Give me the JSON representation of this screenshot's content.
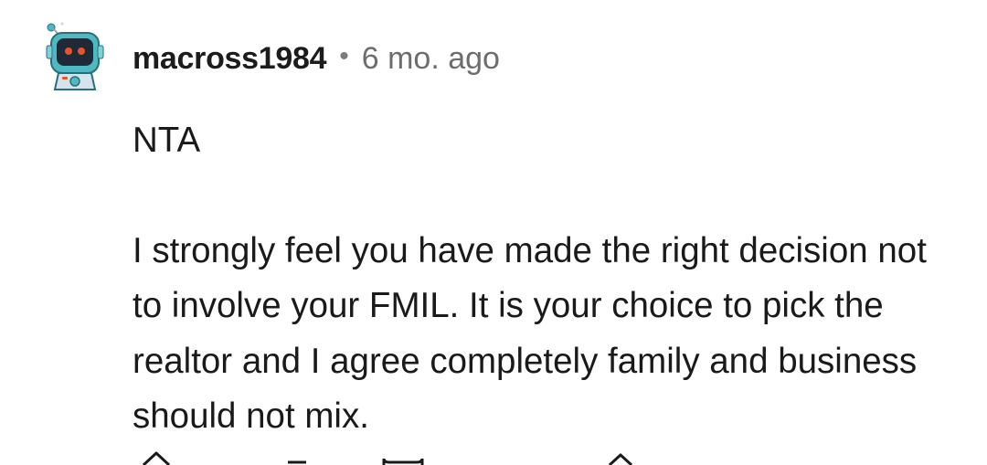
{
  "comment": {
    "username": "macross1984",
    "separator": "•",
    "timestamp": "6 mo. ago",
    "paragraphs": [
      "NTA",
      "I strongly feel you have made the right decision not to involve your FMIL. It is your choice to pick the realtor and I agree completely family and business should not mix."
    ]
  },
  "icons": {
    "avatar": "robot-avatar-icon",
    "actions": [
      "upvote-icon",
      "downvote-icon",
      "reply-icon",
      "share-icon"
    ]
  },
  "colors": {
    "avatar_teal": "#4fb8c2",
    "avatar_dark": "#1f2a36",
    "avatar_eye": "#e8532c",
    "text": "#1a1a1b",
    "muted": "#6d6d6d"
  }
}
